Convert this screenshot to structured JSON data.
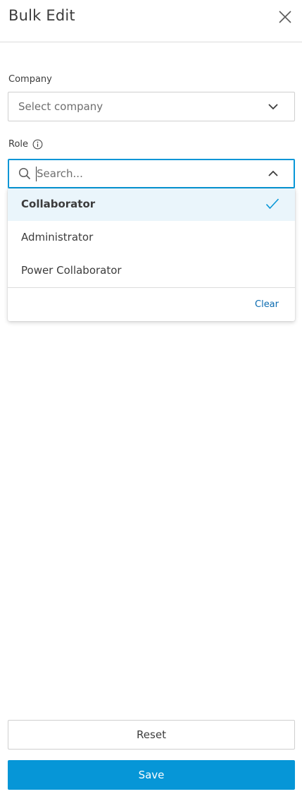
{
  "header": {
    "title": "Bulk Edit",
    "close_icon": "close-icon"
  },
  "company": {
    "label": "Company",
    "placeholder": "Select company",
    "chevron_icon": "chevron-down-icon"
  },
  "role": {
    "label": "Role",
    "info_icon": "info-icon",
    "search_placeholder": "Search...",
    "search_value": "",
    "chevron_icon": "chevron-up-icon",
    "options": [
      {
        "label": "Collaborator",
        "selected": true
      },
      {
        "label": "Administrator",
        "selected": false
      },
      {
        "label": "Power Collaborator",
        "selected": false
      }
    ],
    "clear_label": "Clear"
  },
  "footer": {
    "reset_label": "Reset",
    "save_label": "Save"
  },
  "colors": {
    "accent": "#0696d7",
    "selected_bg": "#eaf5fb",
    "link": "#0a6bb0",
    "text": "#3c3c3c",
    "border": "#cfcfcf"
  }
}
